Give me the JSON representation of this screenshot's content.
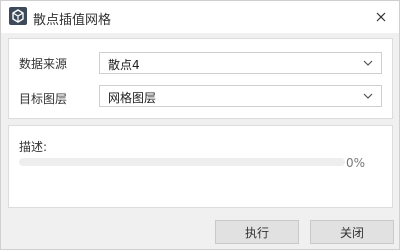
{
  "window": {
    "title": "散点插值网格",
    "app_icon": "app-logo-icon",
    "close_icon": "close-icon"
  },
  "form": {
    "source_label": "数据来源",
    "source_value": "散点4",
    "target_label": "目标图层",
    "target_value": "网格图层",
    "dropdown_icon": "chevron-down-icon"
  },
  "progress": {
    "label": "描述:",
    "value": 0,
    "text": "0%"
  },
  "buttons": {
    "execute": "执行",
    "close": "关闭"
  },
  "colors": {
    "progress_fill": "#4a90d9",
    "title_icon_bg": "#3d4a5a"
  }
}
